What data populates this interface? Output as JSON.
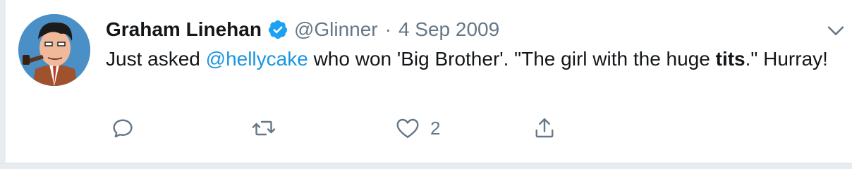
{
  "tweet": {
    "author_name": "Graham Linehan",
    "handle": "@Glinner",
    "separator": "·",
    "date": "4 Sep 2009",
    "text_before": "Just asked ",
    "mention": "@hellycake",
    "text_middle": " who won 'Big Brother'. \"The girl with the huge ",
    "text_bold": "tits",
    "text_after": ".\" Hurray!",
    "like_count": "2"
  },
  "icons": {
    "verified": "verified-badge-icon",
    "more": "chevron-down-icon",
    "reply": "reply-icon",
    "retweet": "retweet-icon",
    "like": "heart-icon",
    "share": "share-icon"
  },
  "colors": {
    "accent": "#1da1f2",
    "mention": "#1b95e0",
    "secondary_text": "#657786",
    "primary_text": "#14171a"
  }
}
